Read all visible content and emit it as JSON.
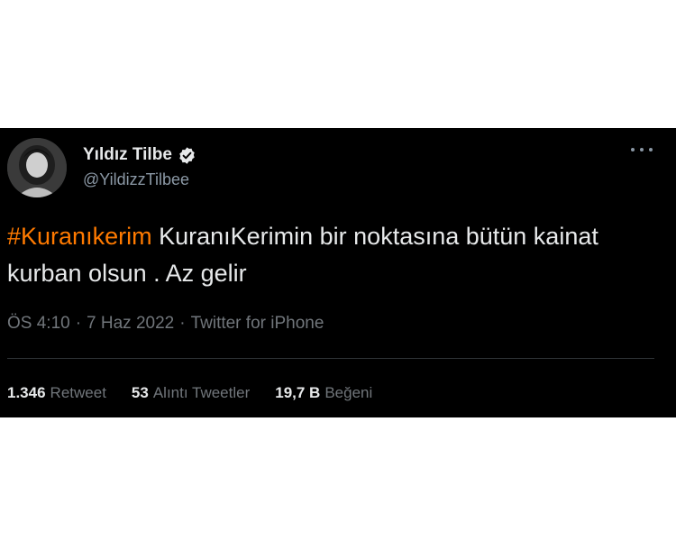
{
  "tweet": {
    "author": {
      "display_name": "Yıldız Tilbe",
      "username": "@YildizzTilbee",
      "verified": true
    },
    "hashtag": "#Kuranıkerim",
    "body": " KuranıKerimin bir noktasına bütün kainat kurban olsun . Az gelir",
    "time": "ÖS 4:10",
    "date": "7 Haz 2022",
    "source": "Twitter for iPhone",
    "separator": "·",
    "stats": [
      {
        "count": "1.346",
        "label": "Retweet"
      },
      {
        "count": "53",
        "label": "Alıntı Tweetler"
      },
      {
        "count": "19,7 B",
        "label": "Beğeni"
      }
    ]
  },
  "icons": {
    "verified": "verified-badge-icon",
    "more": "more-options-icon"
  },
  "colors": {
    "background": "#000000",
    "hashtag": "#ff7a00",
    "text": "#e7e9ea",
    "muted": "#71767b"
  }
}
